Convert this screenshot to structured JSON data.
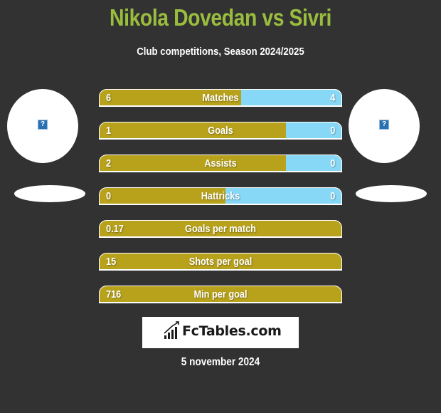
{
  "header": {
    "title": "Nikola Dovedan vs Sivri",
    "subtitle": "Club competitions, Season 2024/2025"
  },
  "players": {
    "left": {
      "name": "Nikola Dovedan",
      "image_icon": "missing-image-icon",
      "icon_glyph": "?"
    },
    "right": {
      "name": "Sivri",
      "image_icon": "missing-image-icon",
      "icon_glyph": "?"
    }
  },
  "colors": {
    "left_bar": "#b8a21b",
    "right_bar": "#87d8f7",
    "title": "#9bbd3e",
    "background": "#323232"
  },
  "stats": [
    {
      "label": "Matches",
      "left": "6",
      "right": "4",
      "left_share": 0.585
    },
    {
      "label": "Goals",
      "left": "1",
      "right": "0",
      "left_share": 0.77
    },
    {
      "label": "Assists",
      "left": "2",
      "right": "0",
      "left_share": 0.77
    },
    {
      "label": "Hattricks",
      "left": "0",
      "right": "0",
      "left_share": 0.52
    },
    {
      "label": "Goals per match",
      "left": "0.17",
      "right": "",
      "left_share": 1.0
    },
    {
      "label": "Shots per goal",
      "left": "15",
      "right": "",
      "left_share": 1.0
    },
    {
      "label": "Min per goal",
      "left": "716",
      "right": "",
      "left_share": 1.0
    }
  ],
  "footer": {
    "logo_text": "FcTables.com",
    "logo_icon": "bar-chart-trend-icon",
    "date": "5 november 2024"
  }
}
